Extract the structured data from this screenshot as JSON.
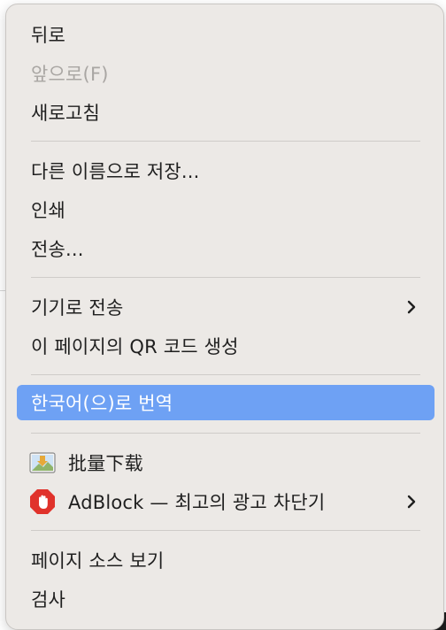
{
  "menu": {
    "items": [
      {
        "label": "뒤로"
      },
      {
        "label": "앞으로(F)"
      },
      {
        "label": "새로고침"
      },
      {
        "label": "다른 이름으로 저장..."
      },
      {
        "label": "인쇄"
      },
      {
        "label": "전송..."
      },
      {
        "label": "기기로 전송"
      },
      {
        "label": "이 페이지의 QR 코드 생성"
      },
      {
        "label": "한국어(으)로 번역"
      },
      {
        "label": "批量下载",
        "icon": "image-download-icon"
      },
      {
        "label": "AdBlock — 최고의 광고 차단기",
        "icon": "adblock-stop-icon"
      },
      {
        "label": "페이지 소스 보기"
      },
      {
        "label": "검사"
      }
    ]
  },
  "colors": {
    "menu_background": "#ece9e6",
    "highlight": "#6ea1f4",
    "text": "#1f1f1f",
    "disabled_text": "#a9a6a3",
    "separator": "#cfccc9",
    "adblock_red": "#e0322b"
  }
}
